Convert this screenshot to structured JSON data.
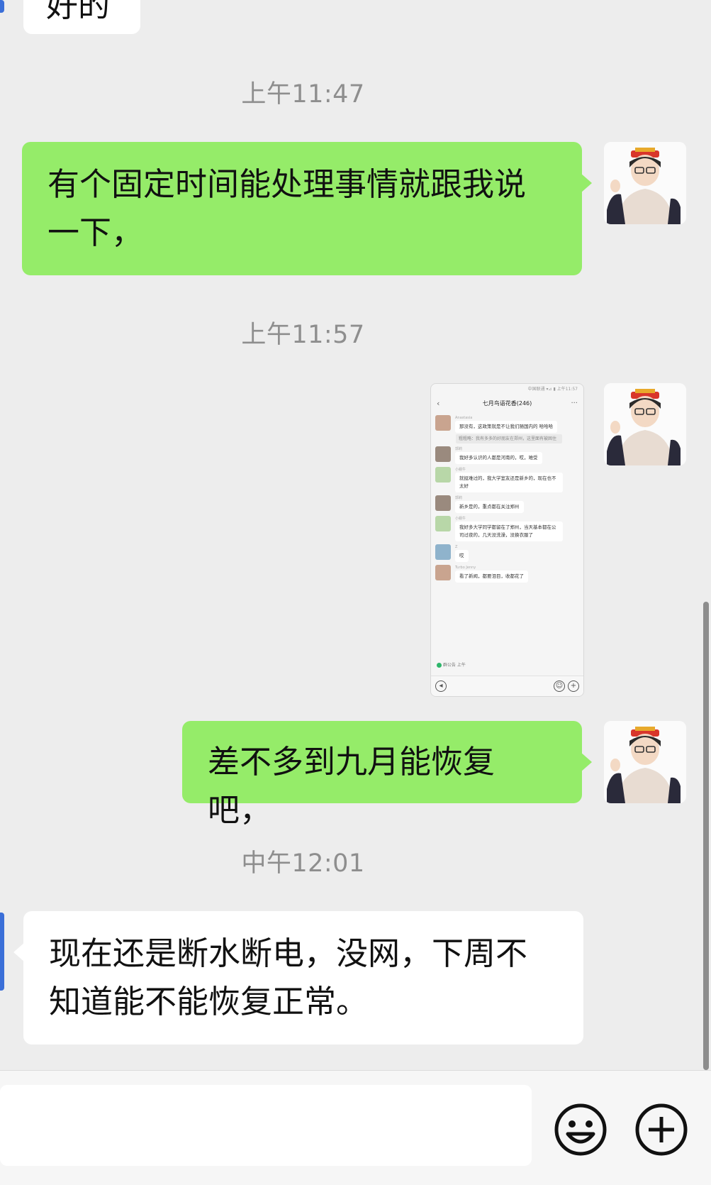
{
  "messages": {
    "top_partial": {
      "text": "好的",
      "sender": "other"
    },
    "ts1": "上午11:47",
    "msg1": {
      "line1": "有个固定时间能处理事情就跟我说",
      "line2": "一下，",
      "sender": "me"
    },
    "ts2": "上午11:57",
    "image_msg": {
      "status_bar": "中国联通 ▾⊿ ▮ 上午11:57",
      "chat_title": "七月鸟语花香(246)",
      "rows": [
        {
          "name": "Anastasia",
          "text": "那没有，这政策就是不让我们随国内的 哈哈哈"
        },
        {
          "system": "粗粗略：我有多多的好朋友在郑州，这里面有被困住"
        },
        {
          "name": "郭莉",
          "text": "我好多认识的人都是河南的，哎，难受"
        },
        {
          "name": "小蜗牛",
          "text": "就挺难过的，我大学室友还是新乡的，现在也不太好"
        },
        {
          "name": "郭莉",
          "text": "新乡是的，重点都在关注郑州"
        },
        {
          "name": "小蜗牛",
          "text": "我好多大学同学都留在了郑州，当天基本都在公司过夜的，几天没洗澡，没换衣服了"
        },
        {
          "name": "Z",
          "text": "哎"
        },
        {
          "name": "Turbo Jenny",
          "text": "看了新闻，都要泪目，收都花了"
        }
      ],
      "reply_hint": "群公告  上午",
      "back_icon": "chevron-left-icon"
    },
    "msg2": {
      "text": "差不多到九月能恢复吧，",
      "sender": "me"
    },
    "ts3": "中午12:01",
    "msg3": {
      "line1": "现在还是断水断电，没网，下周不",
      "line2": "知道能不能恢复正常。",
      "sender": "other"
    }
  },
  "input": {
    "value": "",
    "placeholder": ""
  },
  "icons": {
    "emoji": "smiley-icon",
    "more": "plus-circle-icon"
  },
  "colors": {
    "bg": "#ededed",
    "green_bubble": "#95ec69",
    "white_bubble": "#ffffff",
    "timestamp": "#8e8e8e"
  }
}
